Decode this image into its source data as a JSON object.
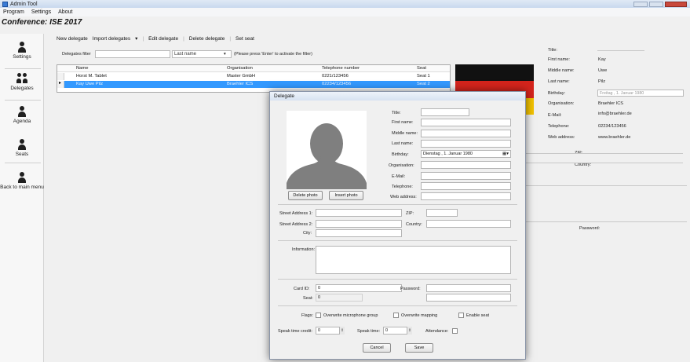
{
  "window": {
    "title": "Admin Tool"
  },
  "menu": {
    "items": [
      "Program",
      "Settings",
      "About"
    ]
  },
  "conference_title": "Conference: ISE 2017",
  "nav": [
    {
      "label": "Settings",
      "icon": "settings-person-icon"
    },
    {
      "label": "Delegates",
      "icon": "delegates-icon"
    },
    {
      "label": "Agenda",
      "icon": "agenda-icon"
    },
    {
      "label": "Seats",
      "icon": "seats-icon"
    },
    {
      "label": "Back to main menu",
      "icon": "back-icon"
    }
  ],
  "toolbar": {
    "new_delegate": "New delegate",
    "import_delegates": "Import delegates",
    "edit_delegate": "Edit delegate",
    "delete_delegate": "Delete delegate",
    "set_seat": "Set seat"
  },
  "filter": {
    "label": "Delegates filter",
    "field": "Last name",
    "hint": "(Please press 'Enter' to activate the filter)"
  },
  "grid": {
    "columns": [
      "Name",
      "Organisation",
      "Telephone number",
      "Seat"
    ],
    "rows": [
      [
        "Horst M. Tablet",
        "Master GmbH",
        "0221/123456",
        "Seat 1"
      ],
      [
        "Kay Uwe Pilz",
        "Braehler ICS",
        "02234/123456",
        "Seat 2"
      ]
    ]
  },
  "flag_colors": [
    "#111111",
    "#d4241c",
    "#f2c200"
  ],
  "details": {
    "title_label": "Title:",
    "first_name_label": "First name:",
    "first_name": "Kay",
    "middle_name_label": "Middle name:",
    "middle_name": "Uwe",
    "last_name_label": "Last name:",
    "last_name": "Pilz",
    "birthday_label": "Birthday:",
    "birthday": "Freitag , 1. Januar 1980",
    "organisation_label": "Organisation:",
    "organisation": "Braehler ICS",
    "email_label": "E-Mail:",
    "email": "info@braehler.de",
    "telephone_label": "Telephone:",
    "telephone": "02234/123456",
    "web_label": "Web address:",
    "web": "www.braehler.de",
    "zip_label": "ZIP:",
    "country_label": "Country:",
    "password_label": "Password:"
  },
  "dialog": {
    "title": "Delegate",
    "delete_photo": "Delete photo",
    "insert_photo": "Insert photo",
    "title_label": "Title:",
    "first_name_label": "First name:",
    "middle_name_label": "Middle name:",
    "last_name_label": "Last name:",
    "birthday_label": "Birthday:",
    "birthday": "Dienstag , 1. Januar 1980",
    "organisation_label": "Organisation:",
    "email_label": "E-Mail:",
    "telephone_label": "Telephone:",
    "web_label": "Web address:",
    "street1_label": "Street Address 1:",
    "street2_label": "Street Address 2:",
    "city_label": "City:",
    "zip_label": "ZIP:",
    "country_label": "Country:",
    "information_label": "Information:",
    "card_id_label": "Card ID:",
    "card_id": "0",
    "seat_label": "Seat:",
    "seat": "0",
    "password_label": "Password:",
    "flags_label": "Flags:",
    "overwrite_mic": "Overwrite microphone group",
    "overwrite_mapping": "Overwrite mapping",
    "enable_seat": "Enable seat",
    "speak_credit_label": "Speak time credit:",
    "speak_credit": "0",
    "speak_time_label": "Speak time:",
    "speak_time": "0",
    "attendance_label": "Attendance:",
    "cancel": "Cancel",
    "save": "Save"
  }
}
